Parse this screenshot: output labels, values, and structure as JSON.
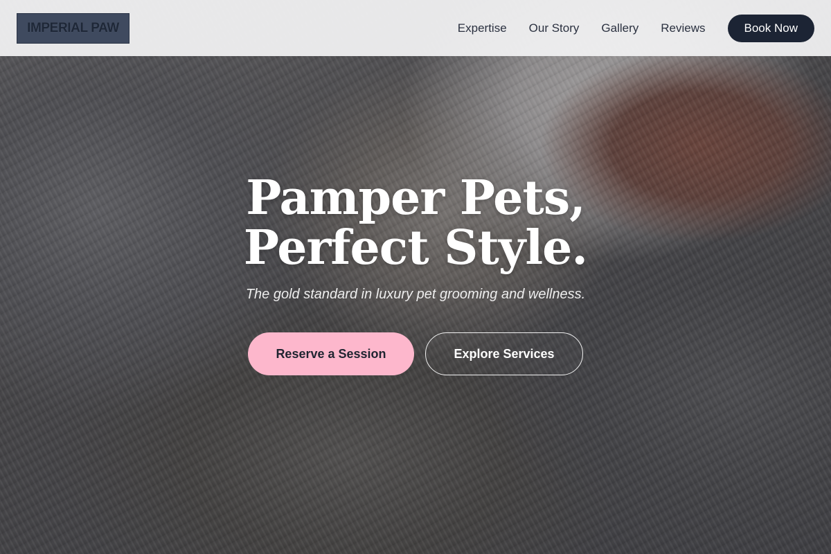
{
  "header": {
    "logo_text": "IMPERIAL PAW",
    "nav": [
      {
        "label": "Expertise"
      },
      {
        "label": "Our Story"
      },
      {
        "label": "Gallery"
      },
      {
        "label": "Reviews"
      }
    ],
    "cta_label": "Book Now"
  },
  "hero": {
    "title_line1": "Pamper Pets,",
    "title_line2": "Perfect Style.",
    "subtitle": "The gold standard in luxury pet grooming and wellness.",
    "primary_cta": "Reserve a Session",
    "secondary_cta": "Explore Services"
  },
  "colors": {
    "brand_dark": "#1c2434",
    "accent_pink": "#fdb7cc",
    "header_bg": "#f0f0f1"
  }
}
